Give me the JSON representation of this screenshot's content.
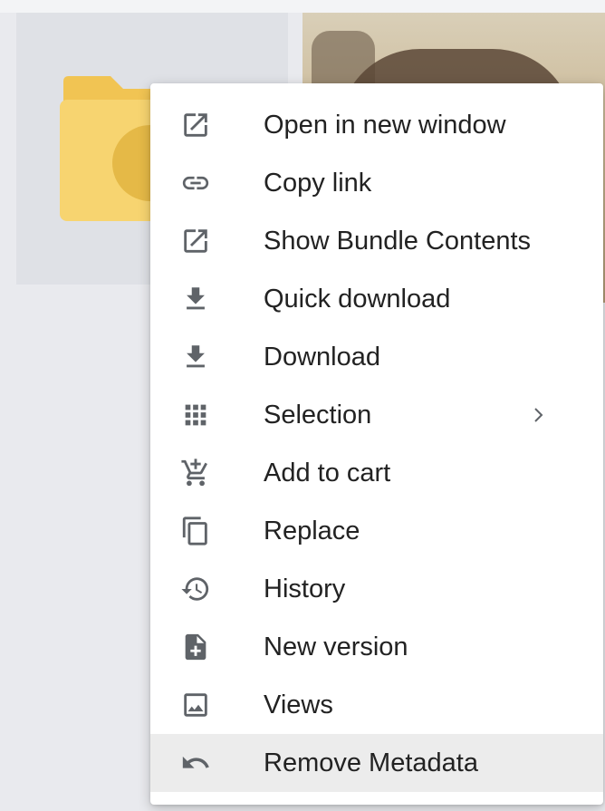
{
  "menu": {
    "items": [
      {
        "label": "Open in new window",
        "icon": "open-in-new-icon"
      },
      {
        "label": "Copy link",
        "icon": "link-icon"
      },
      {
        "label": "Show Bundle Contents",
        "icon": "open-in-new-icon"
      },
      {
        "label": "Quick download",
        "icon": "download-icon"
      },
      {
        "label": "Download",
        "icon": "download-icon"
      },
      {
        "label": "Selection",
        "icon": "grid-icon",
        "submenu": true
      },
      {
        "label": "Add to cart",
        "icon": "add-shopping-cart-icon"
      },
      {
        "label": "Replace",
        "icon": "copy-icon"
      },
      {
        "label": "History",
        "icon": "history-icon"
      },
      {
        "label": "New version",
        "icon": "note-add-icon"
      },
      {
        "label": "Views",
        "icon": "image-icon"
      },
      {
        "label": "Remove Metadata",
        "icon": "undo-icon",
        "highlighted": true
      }
    ]
  },
  "colors": {
    "folder": "#f5cd5e",
    "folder_dark": "#e3b74a",
    "menu_text": "#222222",
    "icon": "#5f6368",
    "highlight": "#ececec"
  }
}
